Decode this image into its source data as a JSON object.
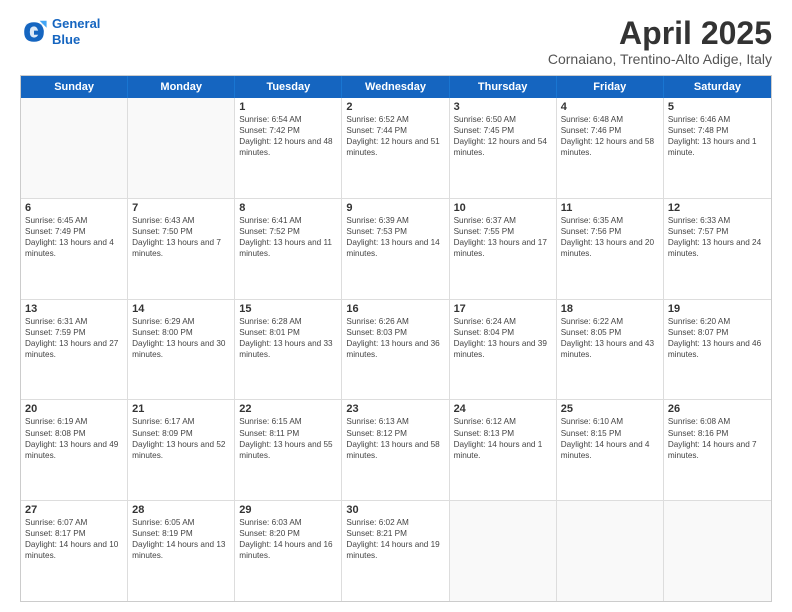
{
  "logo": {
    "line1": "General",
    "line2": "Blue"
  },
  "title": "April 2025",
  "subtitle": "Cornaiano, Trentino-Alto Adige, Italy",
  "header_days": [
    "Sunday",
    "Monday",
    "Tuesday",
    "Wednesday",
    "Thursday",
    "Friday",
    "Saturday"
  ],
  "weeks": [
    [
      {
        "day": "",
        "sunrise": "",
        "sunset": "",
        "daylight": ""
      },
      {
        "day": "",
        "sunrise": "",
        "sunset": "",
        "daylight": ""
      },
      {
        "day": "1",
        "sunrise": "Sunrise: 6:54 AM",
        "sunset": "Sunset: 7:42 PM",
        "daylight": "Daylight: 12 hours and 48 minutes."
      },
      {
        "day": "2",
        "sunrise": "Sunrise: 6:52 AM",
        "sunset": "Sunset: 7:44 PM",
        "daylight": "Daylight: 12 hours and 51 minutes."
      },
      {
        "day": "3",
        "sunrise": "Sunrise: 6:50 AM",
        "sunset": "Sunset: 7:45 PM",
        "daylight": "Daylight: 12 hours and 54 minutes."
      },
      {
        "day": "4",
        "sunrise": "Sunrise: 6:48 AM",
        "sunset": "Sunset: 7:46 PM",
        "daylight": "Daylight: 12 hours and 58 minutes."
      },
      {
        "day": "5",
        "sunrise": "Sunrise: 6:46 AM",
        "sunset": "Sunset: 7:48 PM",
        "daylight": "Daylight: 13 hours and 1 minute."
      }
    ],
    [
      {
        "day": "6",
        "sunrise": "Sunrise: 6:45 AM",
        "sunset": "Sunset: 7:49 PM",
        "daylight": "Daylight: 13 hours and 4 minutes."
      },
      {
        "day": "7",
        "sunrise": "Sunrise: 6:43 AM",
        "sunset": "Sunset: 7:50 PM",
        "daylight": "Daylight: 13 hours and 7 minutes."
      },
      {
        "day": "8",
        "sunrise": "Sunrise: 6:41 AM",
        "sunset": "Sunset: 7:52 PM",
        "daylight": "Daylight: 13 hours and 11 minutes."
      },
      {
        "day": "9",
        "sunrise": "Sunrise: 6:39 AM",
        "sunset": "Sunset: 7:53 PM",
        "daylight": "Daylight: 13 hours and 14 minutes."
      },
      {
        "day": "10",
        "sunrise": "Sunrise: 6:37 AM",
        "sunset": "Sunset: 7:55 PM",
        "daylight": "Daylight: 13 hours and 17 minutes."
      },
      {
        "day": "11",
        "sunrise": "Sunrise: 6:35 AM",
        "sunset": "Sunset: 7:56 PM",
        "daylight": "Daylight: 13 hours and 20 minutes."
      },
      {
        "day": "12",
        "sunrise": "Sunrise: 6:33 AM",
        "sunset": "Sunset: 7:57 PM",
        "daylight": "Daylight: 13 hours and 24 minutes."
      }
    ],
    [
      {
        "day": "13",
        "sunrise": "Sunrise: 6:31 AM",
        "sunset": "Sunset: 7:59 PM",
        "daylight": "Daylight: 13 hours and 27 minutes."
      },
      {
        "day": "14",
        "sunrise": "Sunrise: 6:29 AM",
        "sunset": "Sunset: 8:00 PM",
        "daylight": "Daylight: 13 hours and 30 minutes."
      },
      {
        "day": "15",
        "sunrise": "Sunrise: 6:28 AM",
        "sunset": "Sunset: 8:01 PM",
        "daylight": "Daylight: 13 hours and 33 minutes."
      },
      {
        "day": "16",
        "sunrise": "Sunrise: 6:26 AM",
        "sunset": "Sunset: 8:03 PM",
        "daylight": "Daylight: 13 hours and 36 minutes."
      },
      {
        "day": "17",
        "sunrise": "Sunrise: 6:24 AM",
        "sunset": "Sunset: 8:04 PM",
        "daylight": "Daylight: 13 hours and 39 minutes."
      },
      {
        "day": "18",
        "sunrise": "Sunrise: 6:22 AM",
        "sunset": "Sunset: 8:05 PM",
        "daylight": "Daylight: 13 hours and 43 minutes."
      },
      {
        "day": "19",
        "sunrise": "Sunrise: 6:20 AM",
        "sunset": "Sunset: 8:07 PM",
        "daylight": "Daylight: 13 hours and 46 minutes."
      }
    ],
    [
      {
        "day": "20",
        "sunrise": "Sunrise: 6:19 AM",
        "sunset": "Sunset: 8:08 PM",
        "daylight": "Daylight: 13 hours and 49 minutes."
      },
      {
        "day": "21",
        "sunrise": "Sunrise: 6:17 AM",
        "sunset": "Sunset: 8:09 PM",
        "daylight": "Daylight: 13 hours and 52 minutes."
      },
      {
        "day": "22",
        "sunrise": "Sunrise: 6:15 AM",
        "sunset": "Sunset: 8:11 PM",
        "daylight": "Daylight: 13 hours and 55 minutes."
      },
      {
        "day": "23",
        "sunrise": "Sunrise: 6:13 AM",
        "sunset": "Sunset: 8:12 PM",
        "daylight": "Daylight: 13 hours and 58 minutes."
      },
      {
        "day": "24",
        "sunrise": "Sunrise: 6:12 AM",
        "sunset": "Sunset: 8:13 PM",
        "daylight": "Daylight: 14 hours and 1 minute."
      },
      {
        "day": "25",
        "sunrise": "Sunrise: 6:10 AM",
        "sunset": "Sunset: 8:15 PM",
        "daylight": "Daylight: 14 hours and 4 minutes."
      },
      {
        "day": "26",
        "sunrise": "Sunrise: 6:08 AM",
        "sunset": "Sunset: 8:16 PM",
        "daylight": "Daylight: 14 hours and 7 minutes."
      }
    ],
    [
      {
        "day": "27",
        "sunrise": "Sunrise: 6:07 AM",
        "sunset": "Sunset: 8:17 PM",
        "daylight": "Daylight: 14 hours and 10 minutes."
      },
      {
        "day": "28",
        "sunrise": "Sunrise: 6:05 AM",
        "sunset": "Sunset: 8:19 PM",
        "daylight": "Daylight: 14 hours and 13 minutes."
      },
      {
        "day": "29",
        "sunrise": "Sunrise: 6:03 AM",
        "sunset": "Sunset: 8:20 PM",
        "daylight": "Daylight: 14 hours and 16 minutes."
      },
      {
        "day": "30",
        "sunrise": "Sunrise: 6:02 AM",
        "sunset": "Sunset: 8:21 PM",
        "daylight": "Daylight: 14 hours and 19 minutes."
      },
      {
        "day": "",
        "sunrise": "",
        "sunset": "",
        "daylight": ""
      },
      {
        "day": "",
        "sunrise": "",
        "sunset": "",
        "daylight": ""
      },
      {
        "day": "",
        "sunrise": "",
        "sunset": "",
        "daylight": ""
      }
    ]
  ]
}
